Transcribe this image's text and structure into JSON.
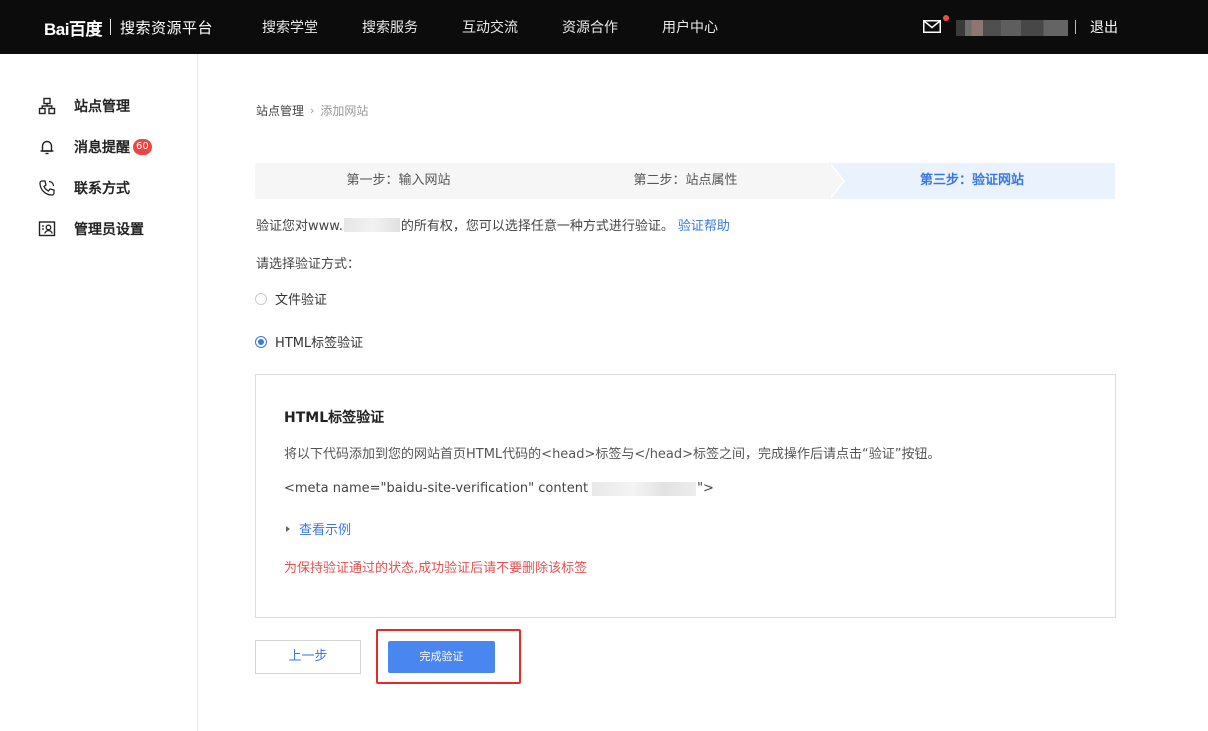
{
  "header": {
    "logo_text": "Bai百度",
    "platform_title": "搜索资源平台",
    "nav": [
      "搜索学堂",
      "搜索服务",
      "互动交流",
      "资源合作",
      "用户中心"
    ],
    "logout_label": "退出",
    "colors": {
      "bg": "#0c0c0c",
      "notify_dot": "#f54b4b"
    }
  },
  "sidebar": {
    "items": [
      {
        "label": "站点管理",
        "icon": "sitemap-icon"
      },
      {
        "label": "消息提醒",
        "icon": "bell-icon",
        "badge": "60"
      },
      {
        "label": "联系方式",
        "icon": "phone-icon"
      },
      {
        "label": "管理员设置",
        "icon": "admin-card-icon"
      }
    ]
  },
  "breadcrumb": {
    "parent": "站点管理",
    "current": "添加网站"
  },
  "steps": [
    "第一步：输入网站",
    "第二步：站点属性",
    "第三步：验证网站"
  ],
  "active_step": 3,
  "verify": {
    "desc_prefix": "验证您对www.",
    "desc_suffix": "的所有权，您可以选择任意一种方式进行验证。",
    "help_link": "验证帮助",
    "choose_label": "请选择验证方式：",
    "methods": [
      {
        "label": "文件验证",
        "selected": false
      },
      {
        "label": "HTML标签验证",
        "selected": true
      }
    ]
  },
  "panel": {
    "title": "HTML标签验证",
    "instruction": "将以下代码添加到您的网站首页HTML代码的<head>标签与</head>标签之间，完成操作后请点击“验证”按钮。",
    "code_prefix": "<meta name=\"baidu-site-verification\" content",
    "code_suffix": "\">",
    "example_link": "查看示例",
    "warning": "为保持验证通过的状态,成功验证后请不要删除该标签"
  },
  "buttons": {
    "prev": "上一步",
    "done": "完成验证"
  },
  "colors": {
    "accent": "#3a78e0",
    "primary_button": "#4a86f0",
    "warning": "#e25252",
    "highlight": "#e52a2a"
  }
}
